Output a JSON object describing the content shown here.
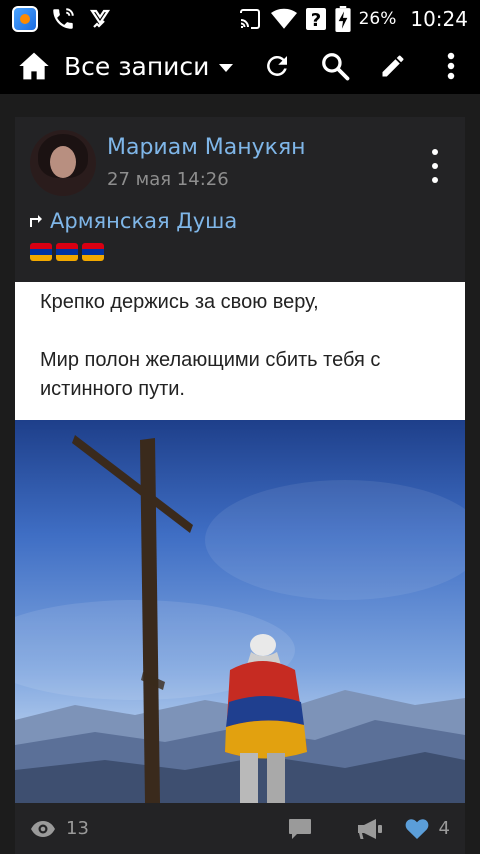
{
  "status_bar": {
    "battery_percent": "26%",
    "time": "10:24",
    "icons": [
      "app-launcher-icon",
      "wifi-call-icon",
      "checkmark-app-icon",
      "cast-icon",
      "wifi-icon",
      "signal-unknown-icon",
      "battery-charging-icon"
    ]
  },
  "toolbar": {
    "title": "Все записи",
    "icons": [
      "home-icon",
      "dropdown-caret-icon",
      "refresh-icon",
      "search-icon",
      "edit-icon",
      "more-vert-icon"
    ]
  },
  "post": {
    "author": "Мариам Манукян",
    "date": "27 мая 14:26",
    "repost_source": "Армянская Душа",
    "flag_count": 3,
    "flag_colors": [
      "#d90012",
      "#0033a0",
      "#f2a800"
    ],
    "text_lines": [
      "Крепко держись за свою веру,",
      "Мир полон желающими сбить тебя с истинного пути."
    ],
    "views": "13",
    "likes": "4",
    "bottom_icons": [
      "eye-icon",
      "comment-icon",
      "repost-megaphone-icon",
      "heart-icon"
    ]
  },
  "colors": {
    "link": "#7fb6e8",
    "card_bg": "#232325",
    "like_heart": "#5b9ed9"
  }
}
